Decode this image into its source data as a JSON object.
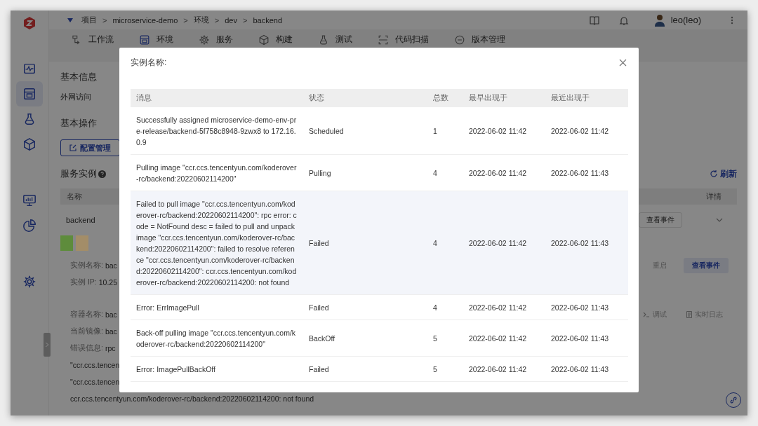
{
  "sidebar": {
    "groups": [
      {
        "items": [
          {
            "kind": "pulse",
            "selected": false
          },
          {
            "kind": "window",
            "selected": true
          },
          {
            "kind": "flask",
            "selected": false
          },
          {
            "kind": "cube",
            "selected": false
          }
        ]
      },
      {
        "items": [
          {
            "kind": "monitor",
            "selected": false
          },
          {
            "kind": "pie",
            "selected": false
          }
        ]
      },
      {
        "items": [
          {
            "kind": "gear",
            "selected": false
          }
        ]
      }
    ]
  },
  "topbar": {
    "breadcrumb": [
      "项目",
      "microservice-demo",
      "环境",
      "dev",
      "backend"
    ],
    "breadcrumb_separator": ">",
    "user": "leo(leo)"
  },
  "tabs": [
    {
      "label": "工作流",
      "kind": "flow",
      "selected": false
    },
    {
      "label": "环境",
      "kind": "window",
      "selected": true
    },
    {
      "label": "服务",
      "kind": "gear",
      "selected": false
    },
    {
      "label": "构建",
      "kind": "cube",
      "selected": false
    },
    {
      "label": "测试",
      "kind": "flask",
      "selected": false
    },
    {
      "label": "代码扫描",
      "kind": "scan",
      "selected": false
    },
    {
      "label": "版本管理",
      "kind": "version",
      "selected": false
    }
  ],
  "content": {
    "basic_info_title": "基本信息",
    "external_access_label": "外网访问",
    "basic_ops_title": "基本操作",
    "config_button": "配置管理",
    "instances_title": "服务实例",
    "refresh_button": "刷新",
    "instance_table": {
      "columns": [
        "名称",
        "详情"
      ],
      "row": {
        "name": "backend",
        "events_button": "查看事件",
        "expanded": true
      }
    },
    "status_blocks": [
      {
        "color": "#5e8c3c"
      },
      {
        "color": "#a38d68"
      }
    ],
    "pod": {
      "lines": [
        {
          "label": "实例名称:",
          "value": "bac"
        },
        {
          "label": "实例 IP:",
          "value": "10.25"
        }
      ],
      "restart_button": "重启",
      "events_button": "查看事件"
    },
    "container": {
      "lines": [
        {
          "label": "容器名称:",
          "value": "bac"
        },
        {
          "label": "当前镜像:",
          "value": "bac"
        },
        {
          "label": "错误信息:",
          "value": "rpc"
        }
      ],
      "error_lines": [
        "\"ccr.ccs.tencen",
        "\"ccr.ccs.tencen",
        "ccr.ccs.tencentyun.com/koderover-rc/backend:20220602114200: not found"
      ],
      "debug_button": "调试",
      "logs_button": "实时日志"
    }
  },
  "modal": {
    "title": "实例名称:",
    "table": {
      "columns": [
        "消息",
        "状态",
        "总数",
        "最早出现于",
        "最近出现于"
      ],
      "rows": [
        {
          "message": "Successfully assigned microservice-demo-env-pre-release/backend-5f758c8948-9zwx8 to 172.16.0.9",
          "status": "Scheduled",
          "count": "1",
          "first_seen": "2022-06-02 11:42",
          "last_seen": "2022-06-02 11:42",
          "hovered": false
        },
        {
          "message": "Pulling image \"ccr.ccs.tencentyun.com/koderover-rc/backend:20220602114200\"",
          "status": "Pulling",
          "count": "4",
          "first_seen": "2022-06-02 11:42",
          "last_seen": "2022-06-02 11:43",
          "hovered": false
        },
        {
          "message": "Failed to pull image \"ccr.ccs.tencentyun.com/koderover-rc/backend:20220602114200\": rpc error: code = NotFound desc = failed to pull and unpack image \"ccr.ccs.tencentyun.com/koderover-rc/backend:20220602114200\": failed to resolve reference \"ccr.ccs.tencentyun.com/koderover-rc/backend:20220602114200\": ccr.ccs.tencentyun.com/koderover-rc/backend:20220602114200: not found",
          "status": "Failed",
          "count": "4",
          "first_seen": "2022-06-02 11:42",
          "last_seen": "2022-06-02 11:43",
          "hovered": true
        },
        {
          "message": "Error: ErrImagePull",
          "status": "Failed",
          "count": "4",
          "first_seen": "2022-06-02 11:42",
          "last_seen": "2022-06-02 11:43",
          "hovered": false
        },
        {
          "message": "Back-off pulling image \"ccr.ccs.tencentyun.com/koderover-rc/backend:20220602114200\"",
          "status": "BackOff",
          "count": "5",
          "first_seen": "2022-06-02 11:42",
          "last_seen": "2022-06-02 11:43",
          "hovered": false
        },
        {
          "message": "Error: ImagePullBackOff",
          "status": "Failed",
          "count": "5",
          "first_seen": "2022-06-02 11:42",
          "last_seen": "2022-06-02 11:43",
          "hovered": false
        }
      ]
    }
  }
}
